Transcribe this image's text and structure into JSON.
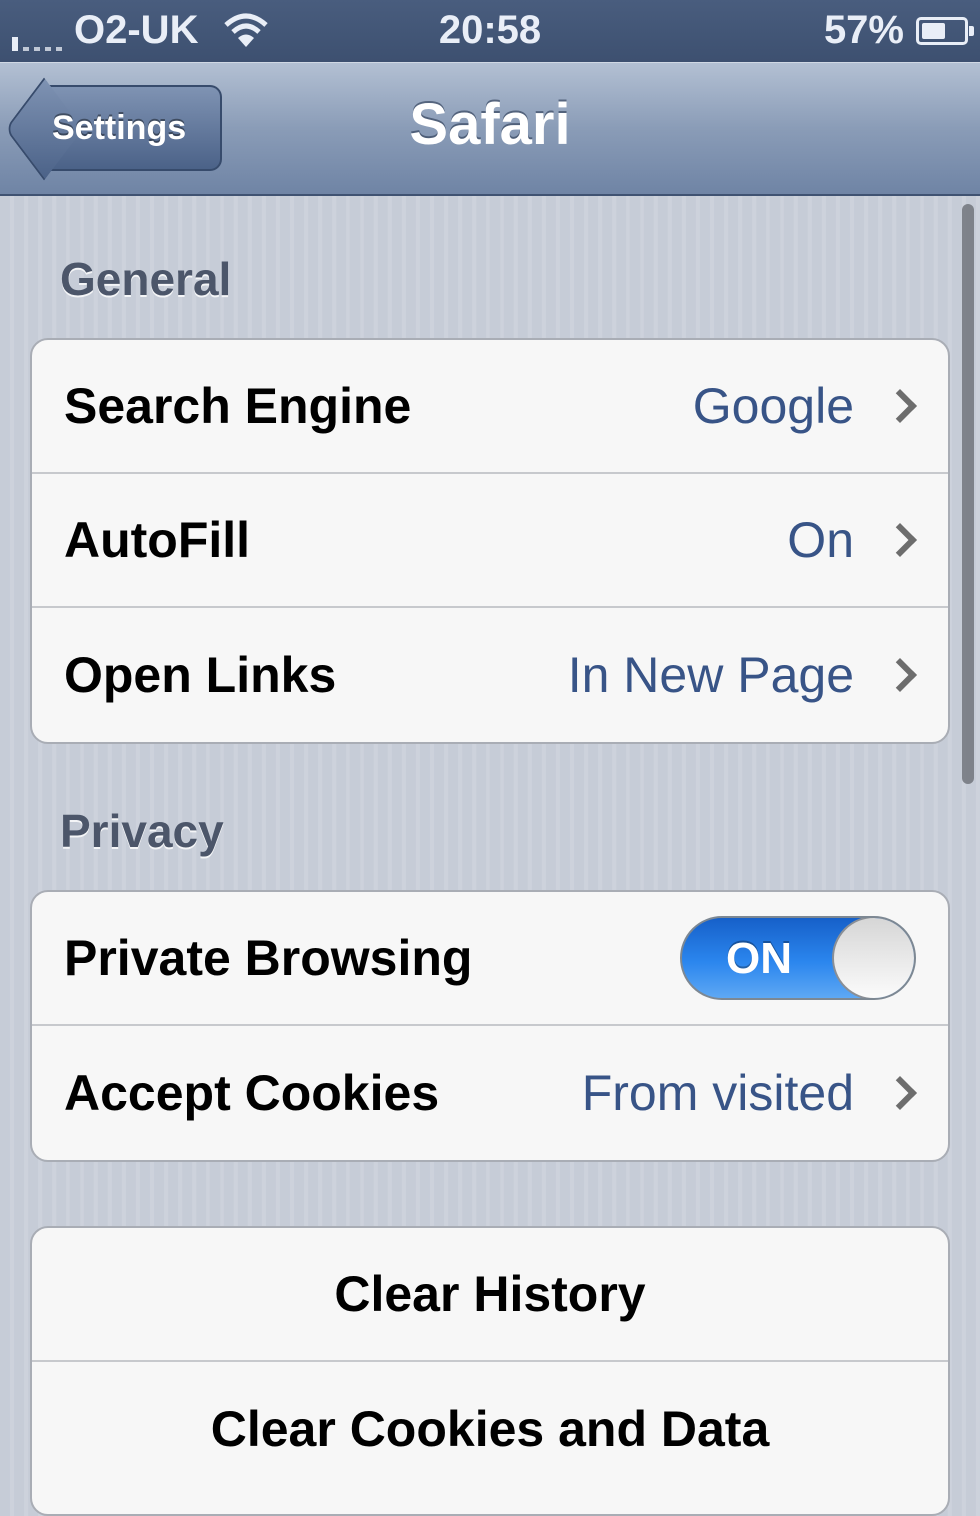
{
  "status_bar": {
    "carrier": "O2-UK",
    "time": "20:58",
    "battery": "57%",
    "battery_level": 0.57,
    "icons": [
      "signal-icon",
      "wifi-icon",
      "battery-icon"
    ]
  },
  "nav": {
    "back_label": "Settings",
    "title": "Safari"
  },
  "general": {
    "header": "General",
    "rows": [
      {
        "label": "Search Engine",
        "value": "Google"
      },
      {
        "label": "AutoFill",
        "value": "On"
      },
      {
        "label": "Open Links",
        "value": "In New Page"
      }
    ]
  },
  "privacy": {
    "header": "Privacy",
    "private_browsing": {
      "label": "Private Browsing",
      "state": "ON"
    },
    "accept_cookies": {
      "label": "Accept Cookies",
      "value": "From visited"
    }
  },
  "actions": {
    "clear_history": "Clear History",
    "clear_cookies": "Clear Cookies and Data"
  },
  "colors": {
    "value_text": "#385487",
    "toggle_on": "#2b86ee",
    "nav_bar": "#8a9cb7"
  }
}
